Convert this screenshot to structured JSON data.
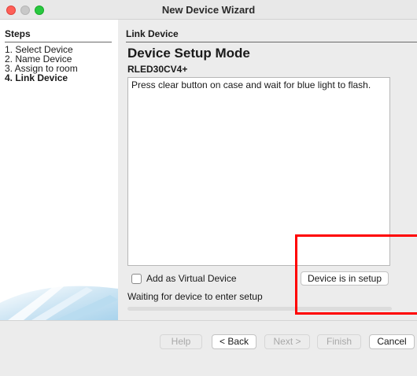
{
  "window": {
    "title": "New Device Wizard"
  },
  "sidebar": {
    "title": "Steps",
    "steps": [
      {
        "label": "1.  Select Device",
        "current": false
      },
      {
        "label": "2.  Name Device",
        "current": false
      },
      {
        "label": "3.  Assign to room",
        "current": false
      },
      {
        "label": "4.  Link Device",
        "current": true
      }
    ]
  },
  "main": {
    "heading": "Link Device",
    "mode_title": "Device Setup Mode",
    "device_model": "RLED30CV4+",
    "instructions": "Press clear button on case and wait for blue light to flash.",
    "virtual_checkbox_label": "Add as Virtual Device",
    "virtual_checked": false,
    "setup_button_label": "Device is in setup",
    "status_text": "Waiting for device to enter setup",
    "progress_fraction": 0
  },
  "footer": {
    "help_label": "Help",
    "back_label": "< Back",
    "next_label": "Next >",
    "finish_label": "Finish",
    "cancel_label": "Cancel"
  },
  "colors": {
    "highlight": "#ff0000",
    "close": "#fe5f57",
    "maximize": "#28c840"
  }
}
